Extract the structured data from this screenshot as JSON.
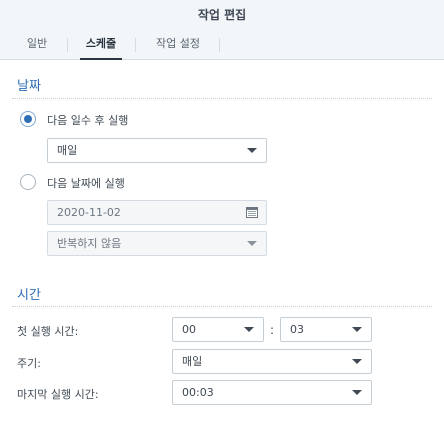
{
  "window": {
    "title": "작업 편집"
  },
  "tabs": [
    {
      "label": "일반",
      "active": false
    },
    {
      "label": "스케줄",
      "active": true
    },
    {
      "label": "작업 설정",
      "active": false
    }
  ],
  "date_section": {
    "title": "날짜",
    "option_run_days": {
      "label": "다음 일수 후 실행",
      "selected": true
    },
    "run_days_select": {
      "value": "매일"
    },
    "option_run_date": {
      "label": "다음 날짜에 실행",
      "selected": false
    },
    "date_input": {
      "value": "2020-11-02",
      "icon": "calendar-icon"
    },
    "repeat_select": {
      "value": "반복하지 않음"
    }
  },
  "time_section": {
    "title": "시간",
    "first_run_label": "첫 실행 시간:",
    "first_run_hour": "00",
    "first_run_minute": "03",
    "time_colon": ":",
    "frequency_label": "주기:",
    "frequency_value": "매일",
    "last_run_label": "마지막 실행 시간:",
    "last_run_value": "00:03"
  },
  "colors": {
    "accent": "#2e6fb3",
    "header_bg": "#f3f6f9",
    "text": "#414b55"
  }
}
